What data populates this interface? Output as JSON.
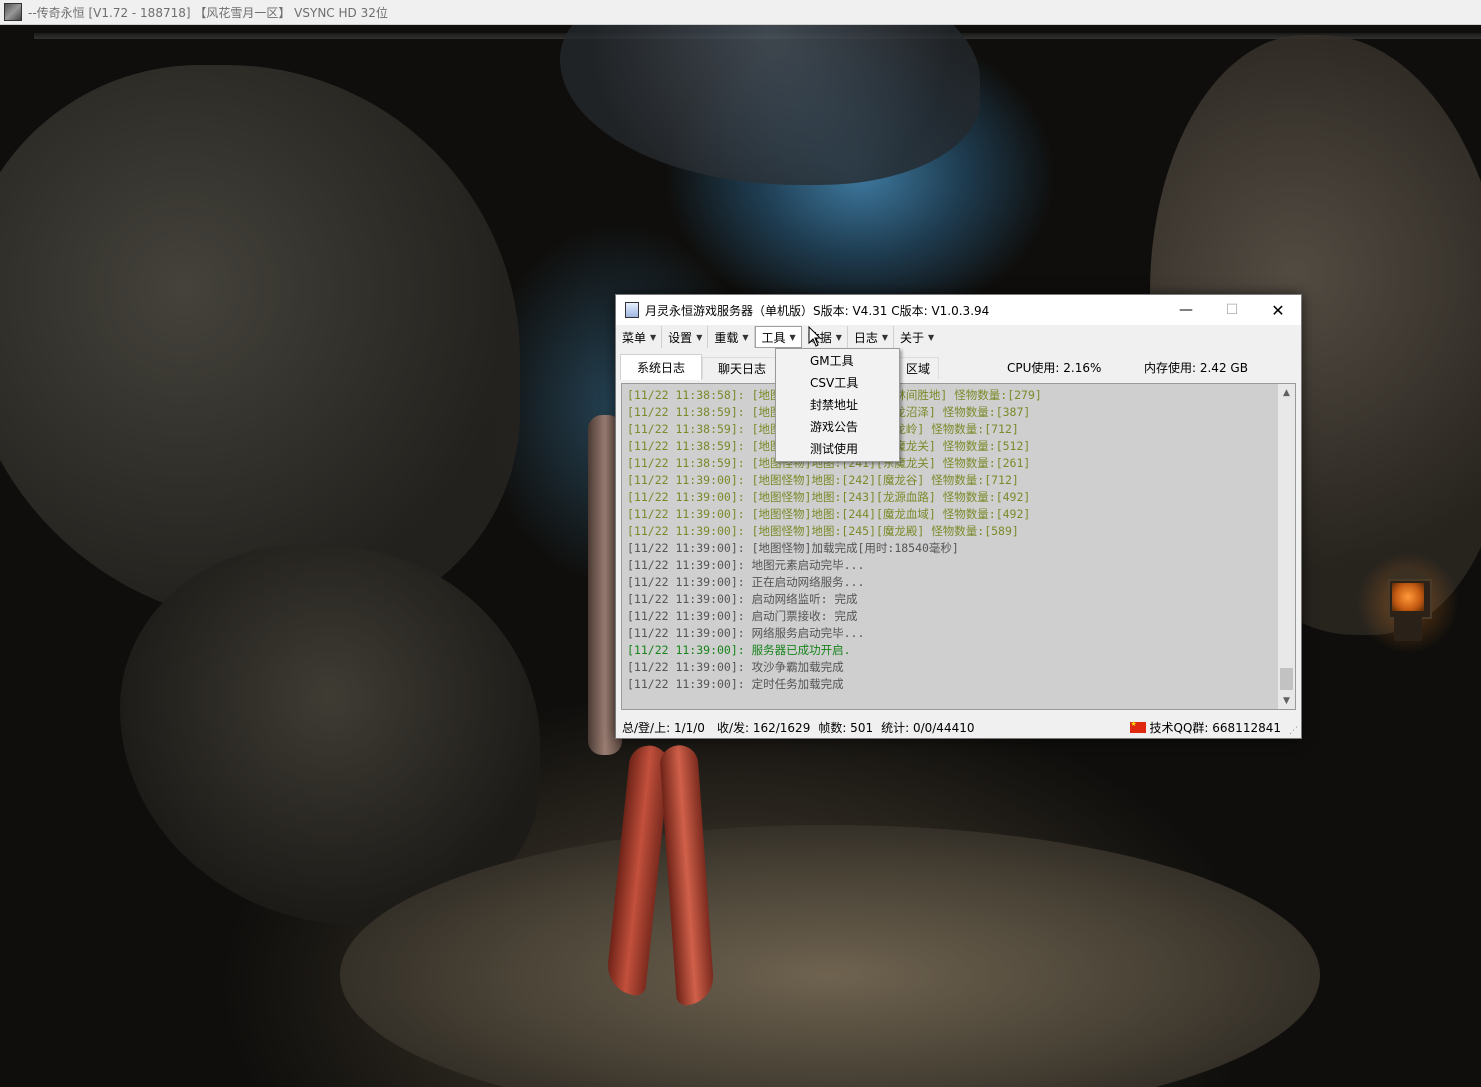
{
  "game_window": {
    "title": "--传奇永恒 [V1.72 - 188718] 【风花雪月一区】 VSYNC HD 32位"
  },
  "server_window": {
    "title": "月灵永恒游戏服务器（单机版）S版本: V4.31 C版本: V1.0.3.94",
    "caption": {
      "minimize": "—",
      "maximize": "☐",
      "close": "✕"
    },
    "menu": [
      {
        "label": "菜单"
      },
      {
        "label": "设置"
      },
      {
        "label": "重载"
      },
      {
        "label": "工具",
        "active": true
      },
      {
        "label": "数据"
      },
      {
        "label": "日志"
      },
      {
        "label": "关于"
      }
    ],
    "tabs": [
      {
        "label": "系统日志",
        "selected": true
      },
      {
        "label": "聊天日志"
      },
      {
        "label": "区域"
      }
    ],
    "cpu": "CPU使用: 2.16%",
    "memory": "内存使用: 2.42 GB",
    "log": [
      {
        "text": "[11/22 11:38:58]: [地图怪物]地图:[201][西林间胜地] 怪物数量:[279]",
        "type": "olive"
      },
      {
        "text": "[11/22 11:38:59]: [地图怪物]地图:[202][魔龙沼泽] 怪物数量:[387]",
        "type": "olive"
      },
      {
        "text": "[11/22 11:38:59]: [地图怪物]地图:[203][魔龙岭] 怪物数量:[712]",
        "type": "olive"
      },
      {
        "text": "[11/22 11:38:59]: [地图怪物]地图:[204][西魔龙关] 怪物数量:[512]",
        "type": "olive"
      },
      {
        "text": "[11/22 11:38:59]: [地图怪物]地图:[241][东魔龙关] 怪物数量:[261]",
        "type": "olive"
      },
      {
        "text": "[11/22 11:39:00]: [地图怪物]地图:[242][魔龙谷] 怪物数量:[712]",
        "type": "olive"
      },
      {
        "text": "[11/22 11:39:00]: [地图怪物]地图:[243][龙源血路] 怪物数量:[492]",
        "type": "olive"
      },
      {
        "text": "[11/22 11:39:00]: [地图怪物]地图:[244][魔龙血域] 怪物数量:[492]",
        "type": "olive"
      },
      {
        "text": "[11/22 11:39:00]: [地图怪物]地图:[245][魔龙殿] 怪物数量:[589]",
        "type": "olive"
      },
      {
        "text": "[11/22 11:39:00]: [地图怪物]加载完成[用时:18540毫秒]",
        "type": "gray"
      },
      {
        "text": "[11/22 11:39:00]: 地图元素启动完毕...",
        "type": "gray"
      },
      {
        "text": "[11/22 11:39:00]: 正在启动网络服务...",
        "type": "gray"
      },
      {
        "text": "[11/22 11:39:00]: 启动网络监听: 完成",
        "type": "gray"
      },
      {
        "text": "[11/22 11:39:00]: 启动门票接收: 完成",
        "type": "gray"
      },
      {
        "text": "[11/22 11:39:00]: 网络服务启动完毕...",
        "type": "gray"
      },
      {
        "text": "[11/22 11:39:00]: 服务器已成功开启.",
        "type": "green"
      },
      {
        "text": "[11/22 11:39:00]: 攻沙争霸加载完成",
        "type": "gray"
      },
      {
        "text": "[11/22 11:39:00]: 定时任务加载完成",
        "type": "gray"
      }
    ],
    "status": {
      "counts": "总/登/上: 1/1/0",
      "traffic": "收/发: 162/1629",
      "fps": "帧数: 501",
      "stats": "统计: 0/0/44410",
      "qq_group": "技术QQ群: 668112841"
    }
  },
  "tools_menu": {
    "items": [
      "GM工具",
      "CSV工具",
      "封禁地址",
      "游戏公告",
      "测试使用"
    ]
  }
}
